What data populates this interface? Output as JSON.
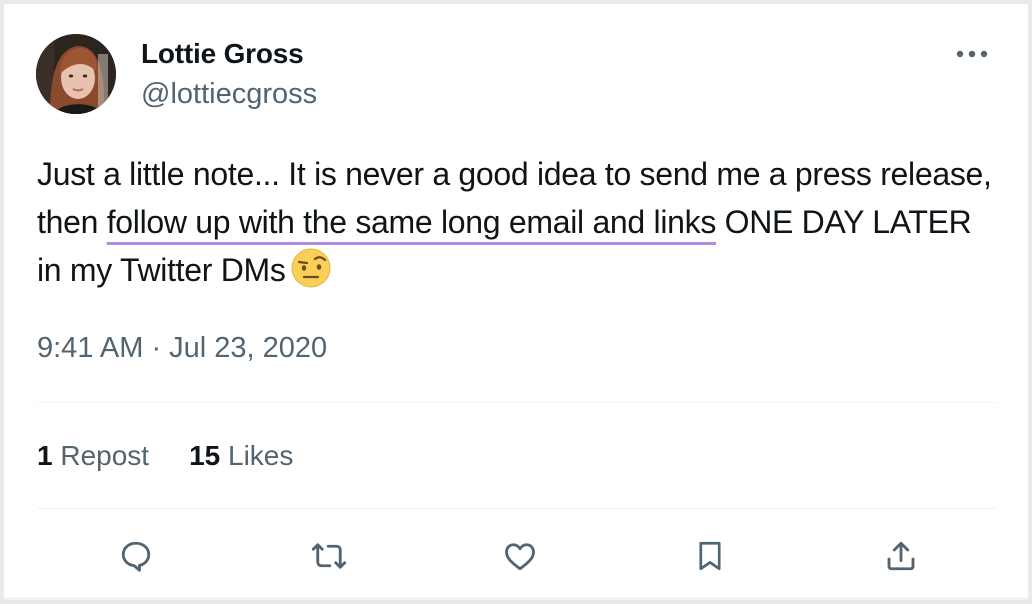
{
  "author": {
    "name": "Lottie Gross",
    "handle": "@lottiecgross"
  },
  "tweet": {
    "text_before": "Just a little note... It is never a good idea to send me a press release, then ",
    "text_highlight": "follow up with the same long email and links",
    "text_after": " ONE DAY LATER in my Twitter DMs",
    "emoji": "face-with-raised-eyebrow",
    "timestamp": "9:41 AM · Jul 23, 2020"
  },
  "stats": {
    "reposts_count": "1",
    "reposts_label": "Repost",
    "likes_count": "15",
    "likes_label": "Likes"
  },
  "icons": {
    "more": "more-horizontal-icon",
    "reply": "reply-icon",
    "repost": "repost-icon",
    "like": "like-icon",
    "bookmark": "bookmark-icon",
    "share": "share-icon"
  },
  "colors": {
    "text": "#0f1419",
    "secondary": "#536471",
    "highlight_underline": "#b48be6"
  }
}
